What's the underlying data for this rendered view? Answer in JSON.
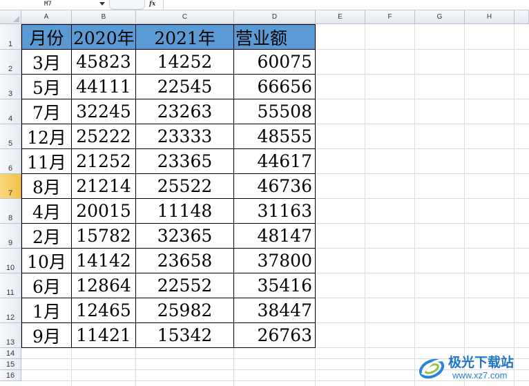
{
  "formula_bar": {
    "cell_reference": "M7",
    "fx_label": "fx",
    "formula_value": ""
  },
  "columns": [
    "A",
    "B",
    "C",
    "D",
    "E",
    "F",
    "G",
    "H"
  ],
  "rows": [
    "1",
    "2",
    "3",
    "4",
    "5",
    "6",
    "7",
    "8",
    "9",
    "10",
    "11",
    "12",
    "13",
    "14",
    "15",
    "16"
  ],
  "active_row": "7",
  "table": {
    "headers": [
      "月份",
      "2020年",
      "2021年",
      "营业额"
    ],
    "header_fill": "#5b9bd5",
    "rows": [
      [
        "3月",
        "45823",
        "14252",
        "60075"
      ],
      [
        "5月",
        "44111",
        "22545",
        "66656"
      ],
      [
        "7月",
        "32245",
        "23263",
        "55508"
      ],
      [
        "12月",
        "25222",
        "23333",
        "48555"
      ],
      [
        "11月",
        "21252",
        "23365",
        "44617"
      ],
      [
        "8月",
        "21214",
        "25522",
        "46736"
      ],
      [
        "4月",
        "20015",
        "11148",
        "31163"
      ],
      [
        "2月",
        "15782",
        "32365",
        "48147"
      ],
      [
        "10月",
        "14142",
        "23658",
        "37800"
      ],
      [
        "6月",
        "12864",
        "22552",
        "35416"
      ],
      [
        "1月",
        "12465",
        "25982",
        "38447"
      ],
      [
        "9月",
        "11421",
        "15342",
        "26763"
      ]
    ]
  },
  "watermark": {
    "title": "极光下载站",
    "url": "www.xz7.com",
    "logo_icon": "swirl-logo"
  }
}
